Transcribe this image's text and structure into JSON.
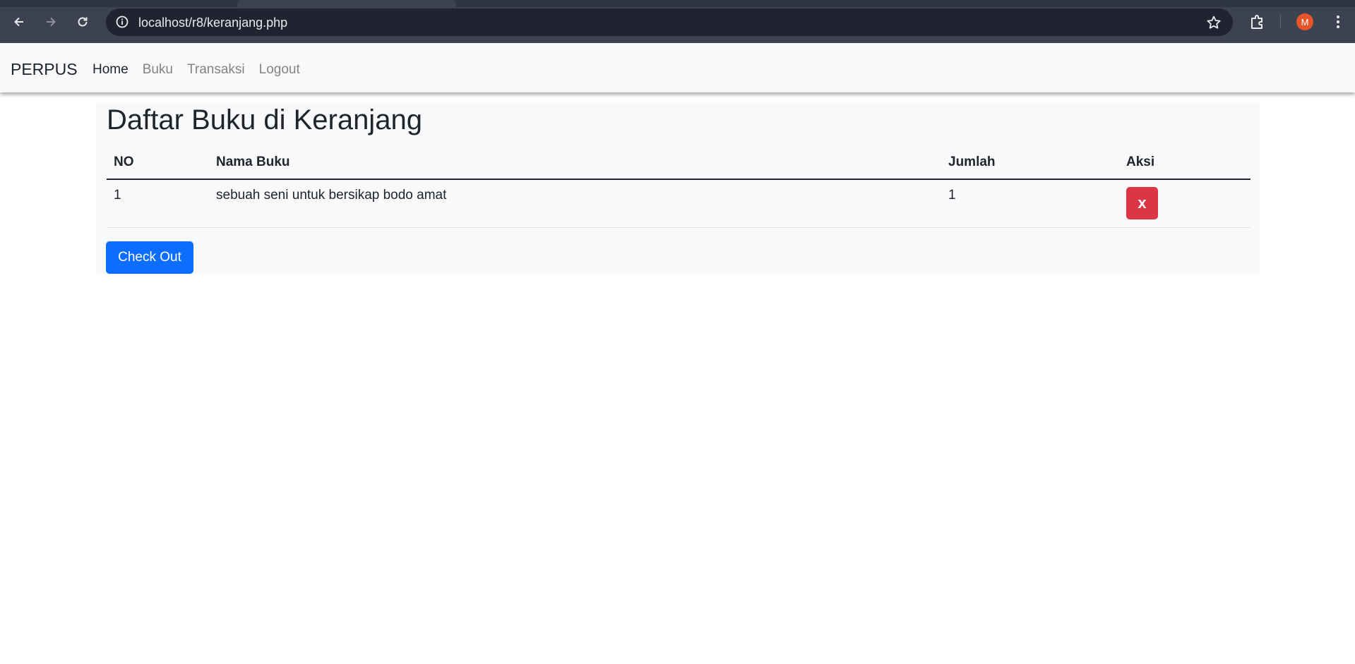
{
  "browser": {
    "url": "localhost/r8/keranjang.php",
    "profile_initial": "M"
  },
  "navbar": {
    "brand": "PERPUS",
    "links": [
      {
        "label": "Home",
        "active": true
      },
      {
        "label": "Buku",
        "active": false
      },
      {
        "label": "Transaksi",
        "active": false
      },
      {
        "label": "Logout",
        "active": false
      }
    ]
  },
  "main": {
    "title": "Daftar Buku di Keranjang",
    "table": {
      "headers": [
        "NO",
        "Nama Buku",
        "Jumlah",
        "Aksi"
      ],
      "rows": [
        {
          "no": "1",
          "name": "sebuah seni untuk bersikap bodo amat",
          "qty": "1",
          "action_label": "x"
        }
      ]
    },
    "checkout_label": "Check Out"
  },
  "colors": {
    "danger": "#dc3545",
    "primary": "#0d6efd",
    "navbar_bg": "#f8f9fa"
  }
}
